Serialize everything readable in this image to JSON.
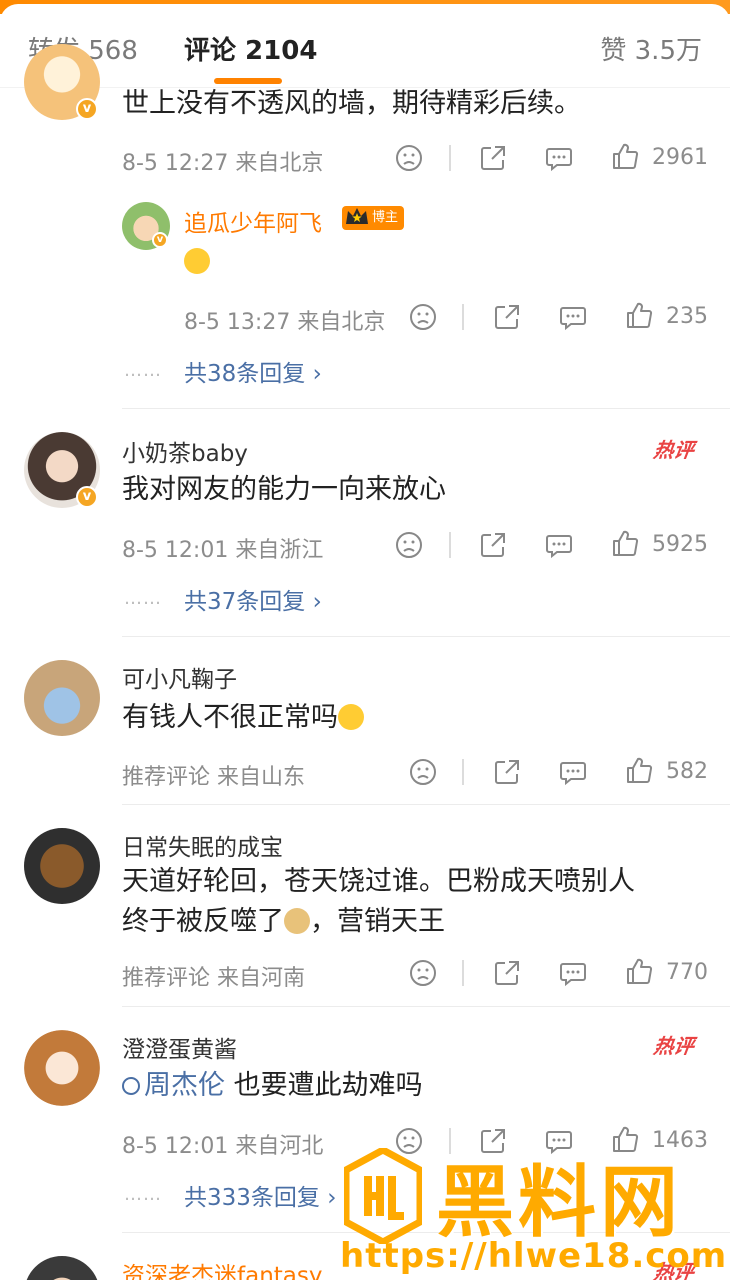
{
  "tabs": {
    "repost": "转发 568",
    "comments": "评论 2104",
    "likes": "赞 3.5万"
  },
  "comments": [
    {
      "text": "世上没有不透风的墙，期待精彩后续。",
      "meta": "8-5 12:27  来自北京",
      "likes": "2961",
      "reply": {
        "username": "追瓜少年阿飞",
        "badge": "博主",
        "meta": "8-5 13:27  来自北京",
        "likes": "235"
      },
      "replies": "共38条回复 ›"
    },
    {
      "username": "小奶茶baby",
      "hot": "热评",
      "text": "我对网友的能力一向来放心",
      "meta": "8-5 12:01  来自浙江",
      "likes": "5925",
      "replies": "共37条回复 ›"
    },
    {
      "username": "可小凡鞠子",
      "text": "有钱人不很正常吗",
      "meta": "推荐评论  来自山东",
      "likes": "582"
    },
    {
      "username": "日常失眠的成宝",
      "text_line1": "天道好轮回，苍天饶过谁。巴粉成天喷别人",
      "text_line2a": "终于被反噬了",
      "text_line2b": "，营销天王",
      "meta": "推荐评论  来自河南",
      "likes": "770"
    },
    {
      "username": "澄澄蛋黄酱",
      "hot": "热评",
      "topic": "周杰伦",
      "text": " 也要遭此劫难吗",
      "meta": "8-5 12:01  来自河北",
      "likes": "1463",
      "replies": "共333条回复 ›"
    },
    {
      "username": "资深老杰迷fantasy",
      "hot": "热评"
    }
  ],
  "dots": "……",
  "watermark": {
    "title": "黑料网",
    "url": "https://hlwe18.com"
  },
  "colors": {
    "accent": "#ff8200",
    "link": "#4a6fa5",
    "hot": "#e94343"
  }
}
